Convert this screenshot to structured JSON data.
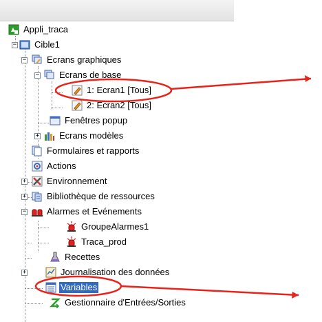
{
  "tree": {
    "root": "Appli_traca",
    "target": "Cible1",
    "screens_group": "Ecrans graphiques",
    "base_screens": "Ecrans de base",
    "screen1": "1: Ecran1 [Tous]",
    "screen2": "2: Ecran2 [Tous]",
    "popup_windows": "Fenêtres popup",
    "template_screens": "Ecrans modèles",
    "forms_reports": "Formulaires et rapports",
    "actions": "Actions",
    "environment": "Environnement",
    "resource_library": "Bibliothèque de ressources",
    "alarms_events": "Alarmes et Evénements",
    "alarm_group": "GroupeAlarmes1",
    "traca_prod": "Traca_prod",
    "recipes": "Recettes",
    "data_logging": "Journalisation des données",
    "variables": "Variables",
    "io_manager": "Gestionnaire d'Entrées/Sorties"
  },
  "expanders": {
    "collapsed": "+",
    "expanded": "−"
  },
  "colors": {
    "annotation": "#e8231a",
    "selection": "#316ac5"
  }
}
